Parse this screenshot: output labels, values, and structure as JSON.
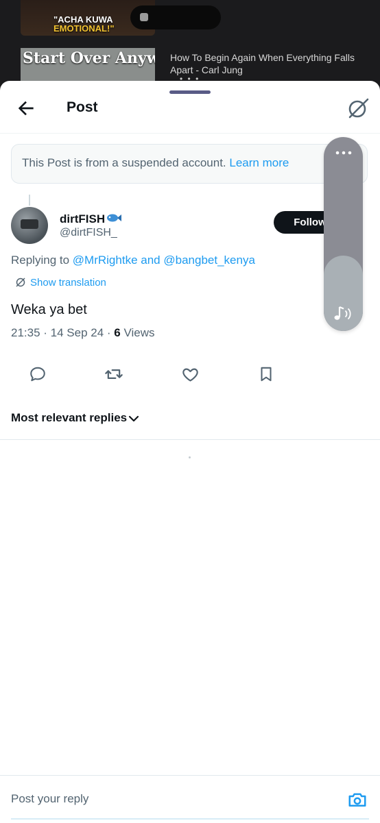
{
  "background": {
    "thumb_top_caption_line1": "\"ACHA KUWA",
    "thumb_top_caption_line2": "EMOTIONAL!\"",
    "thumb2_overlay": "Start Over Anyway",
    "video_title": "How To Begin Again When Everything Falls Apart - Carl Jung"
  },
  "header": {
    "title": "Post"
  },
  "notice": {
    "text": "This Post is from a suspended account.",
    "link": "Learn more"
  },
  "post": {
    "display_name": "dirtFISH",
    "handle": "@dirtFISH_",
    "follow_label": "Follow",
    "replying_prefix": "Replying to",
    "mention_1": "@MrRightke",
    "replying_and": "and",
    "mention_2": "@bangbet_kenya",
    "translate_label": "Show translation",
    "text": "Weka ya bet",
    "timestamp": "21:35 · 14 Sep 24 ·",
    "views_count": "6",
    "views_label": "Views"
  },
  "sort": {
    "label": "Most relevant replies"
  },
  "volume": {
    "level": 0.39
  },
  "reply": {
    "placeholder": "Post your reply"
  },
  "colors": {
    "accent": "#1d9bf0",
    "text": "#0f1419",
    "secondary": "#536471",
    "follow_bg": "#0f1419"
  },
  "icons": {
    "back": "arrow-left-icon",
    "grok": "grok-icon",
    "fish": "fish-emoji-icon",
    "more": "more-vertical-icon",
    "reply": "reply-icon",
    "repost": "repost-icon",
    "like": "heart-icon",
    "bookmark": "bookmark-icon",
    "camera": "camera-icon",
    "music": "music-note-icon"
  }
}
